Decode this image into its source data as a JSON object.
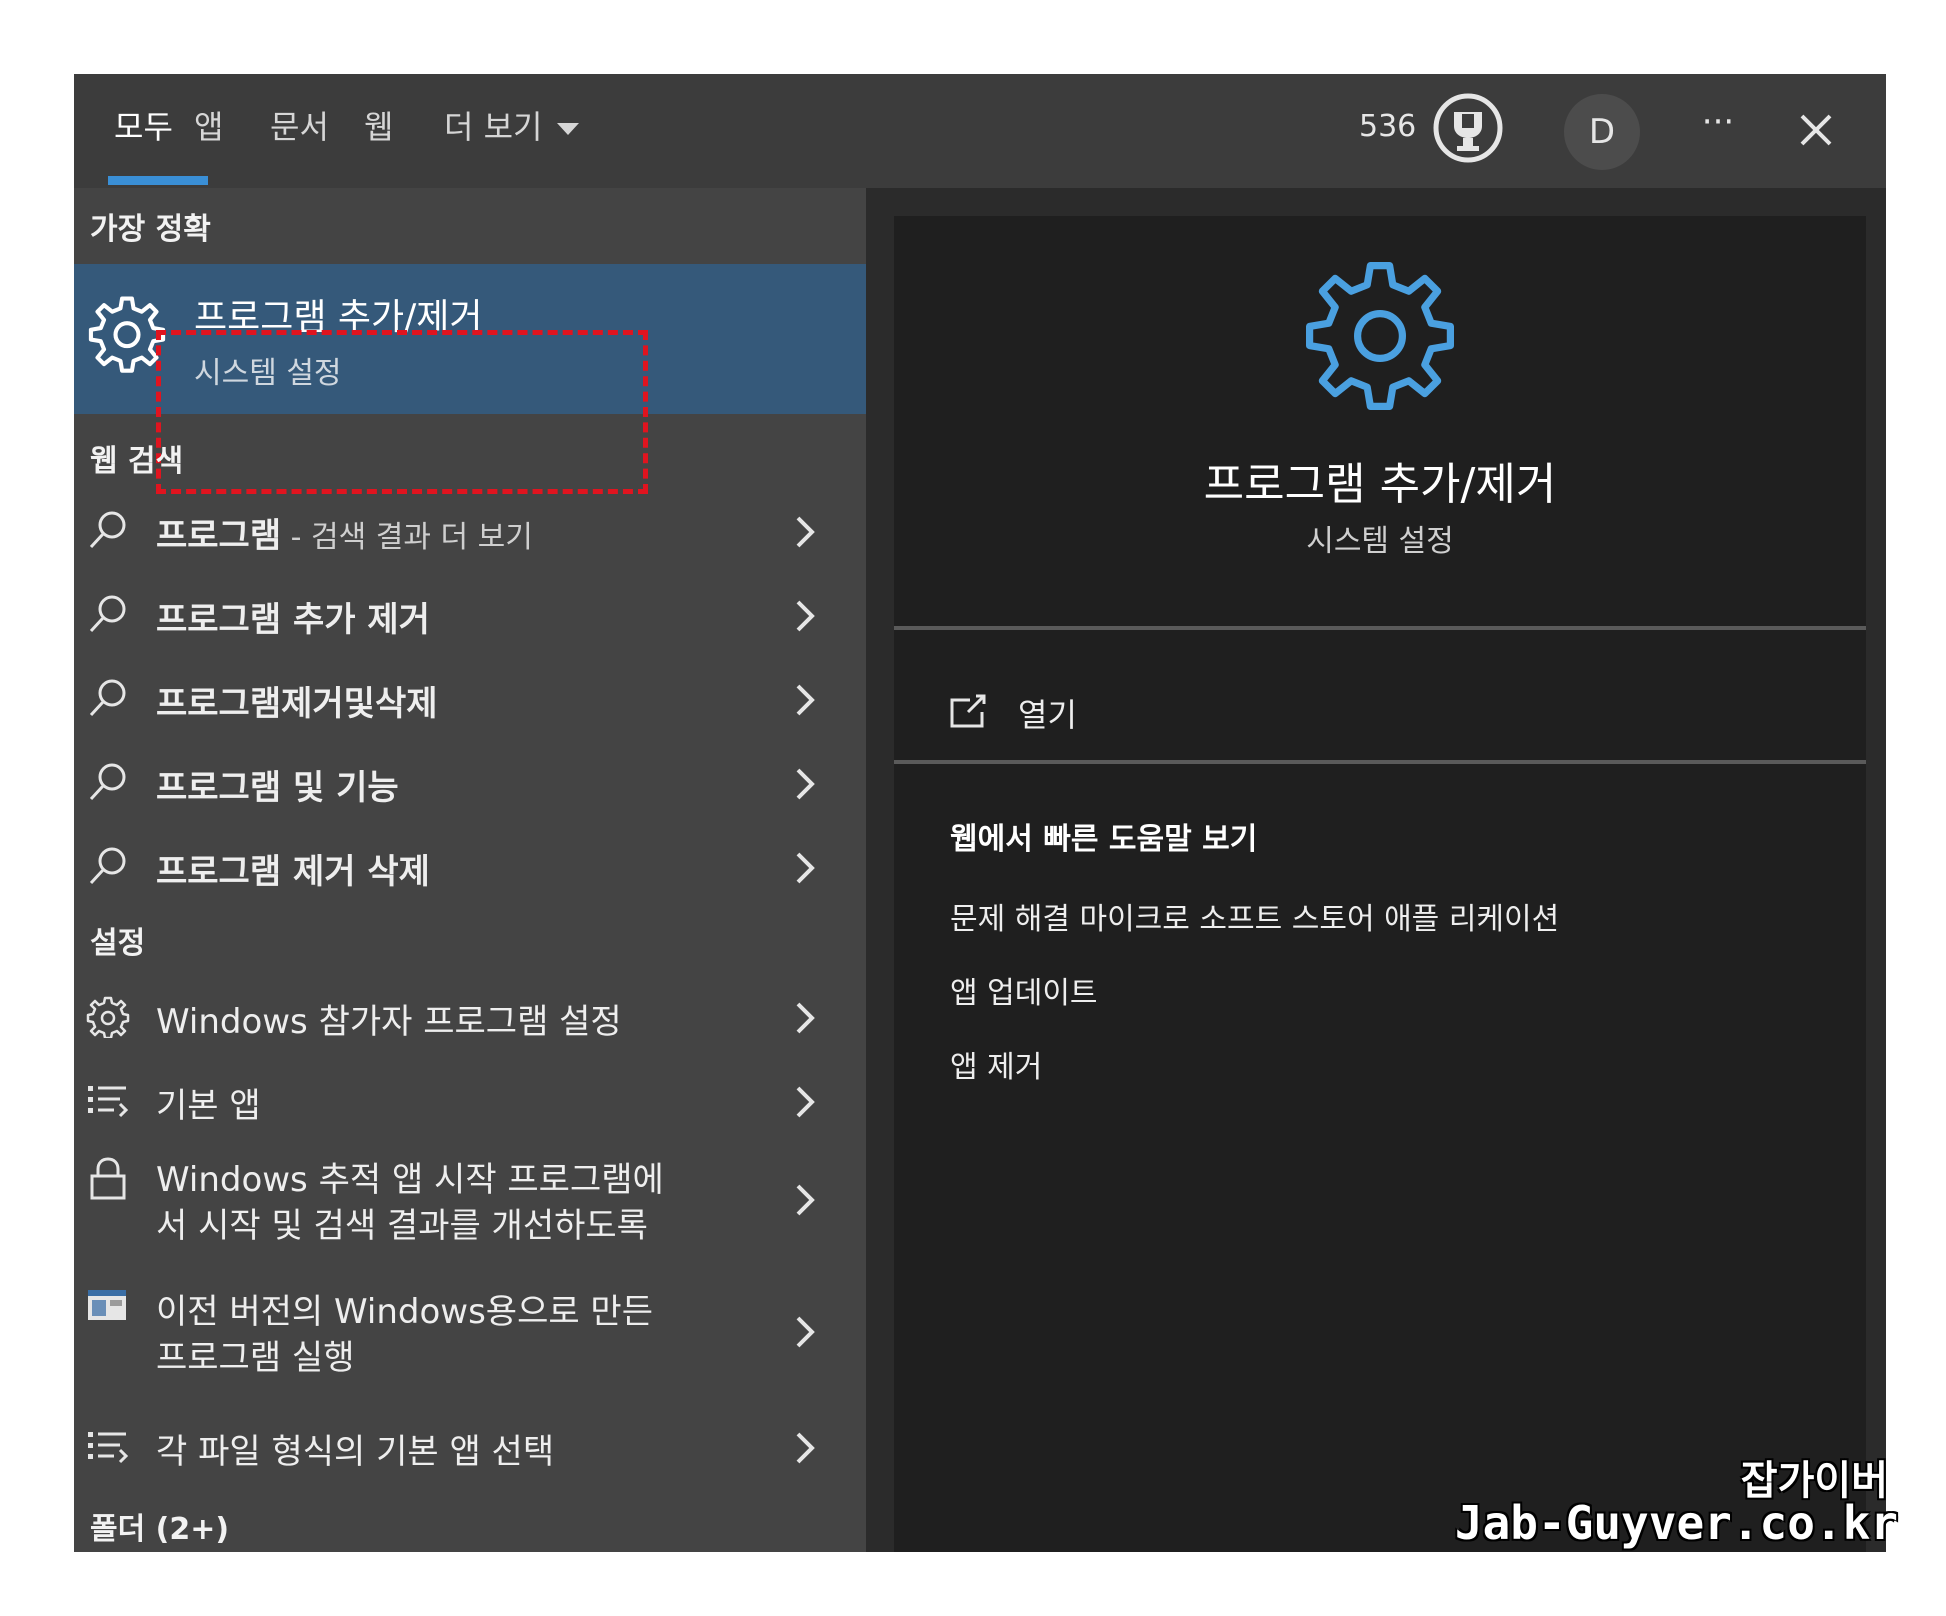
{
  "tabs": [
    {
      "label": "모두",
      "active": true
    },
    {
      "label": "앱"
    },
    {
      "label": "문서"
    },
    {
      "label": "웹"
    },
    {
      "label": "더 보기"
    }
  ],
  "header": {
    "points": "536",
    "avatar_letter": "D",
    "more_label": "···"
  },
  "left": {
    "best_match_heading": "가장 정확",
    "best_match": {
      "title": "프로그램 추가/제거",
      "subtitle": "시스템 설정"
    },
    "web_heading": "웹 검색",
    "web_items": [
      {
        "bold": "프로그램",
        "rest": " - 검색 결과 더 보기"
      },
      {
        "bold": "프로그램 추가 제거",
        "rest": ""
      },
      {
        "bold": "프로그램제거및삭제",
        "rest": ""
      },
      {
        "bold": "프로그램 및 기능",
        "rest": ""
      },
      {
        "bold": "프로그램 제거 삭제",
        "rest": ""
      }
    ],
    "settings_heading": "설정",
    "settings_items": [
      {
        "line1": "Windows 참가자 프로그램 설정",
        "line2": "",
        "icon": "gear-icon"
      },
      {
        "line1": "기본 앱",
        "line2": "",
        "icon": "list-icon"
      },
      {
        "line1": "Windows 추적 앱 시작 프로그램에",
        "line2": "서 시작 및 검색 결과를 개선하도록",
        "icon": "lock-icon"
      },
      {
        "line1": "이전 버전의 Windows용으로 만든",
        "line2": "프로그램 실행",
        "icon": "window-icon"
      },
      {
        "line1": "각 파일 형식의 기본 앱 선택",
        "line2": "",
        "icon": "list-icon"
      }
    ],
    "folder_heading": "폴더 (2+)"
  },
  "right": {
    "title": "프로그램 추가/제거",
    "subtitle": "시스템 설정",
    "open_label": "열기",
    "help_heading": "웹에서 빠른 도움말 보기",
    "help_links": [
      "문제 해결 마이크로 소프트 스토어 애플 리케이션",
      "앱 업데이트",
      "앱 제거"
    ]
  },
  "watermark": {
    "line1": "잡가이버",
    "line2": "Jab-Guyver.co.kr"
  },
  "colors": {
    "accent": "#3a8fd6",
    "selected": "#35597a",
    "highlight": "#e0141f"
  }
}
